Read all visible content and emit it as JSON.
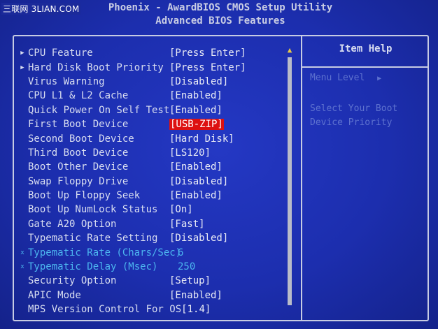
{
  "watermark": "三联网 3LIAN.COM",
  "header": {
    "line1": "Phoenix - AwardBIOS CMOS Setup Utility",
    "line2": "Advanced BIOS Features"
  },
  "items": [
    {
      "marker": "▶",
      "label": "CPU Feature",
      "value": "[Press Enter]"
    },
    {
      "marker": "▶",
      "label": "Hard Disk Boot Priority",
      "value": "[Press Enter]"
    },
    {
      "marker": "",
      "label": "Virus Warning",
      "value": "[Disabled]"
    },
    {
      "marker": "",
      "label": "CPU L1 & L2 Cache",
      "value": "[Enabled]"
    },
    {
      "marker": "",
      "label": "Quick Power On Self Test",
      "value": "[Enabled]"
    },
    {
      "marker": "",
      "label": "First Boot Device",
      "value": "[USB-ZIP]"
    },
    {
      "marker": "",
      "label": "Second Boot Device",
      "value": "[Hard Disk]"
    },
    {
      "marker": "",
      "label": "Third Boot Device",
      "value": "[LS120]"
    },
    {
      "marker": "",
      "label": "Boot Other Device",
      "value": "[Enabled]"
    },
    {
      "marker": "",
      "label": "Swap Floppy Drive",
      "value": "[Disabled]"
    },
    {
      "marker": "",
      "label": "Boot Up Floppy Seek",
      "value": "[Enabled]"
    },
    {
      "marker": "",
      "label": "Boot Up NumLock Status",
      "value": "[On]"
    },
    {
      "marker": "",
      "label": "Gate A20 Option",
      "value": "[Fast]"
    },
    {
      "marker": "",
      "label": "Typematic Rate Setting",
      "value": "[Disabled]"
    },
    {
      "marker": "x",
      "label": "Typematic Rate (Chars/Sec)",
      "value": "6"
    },
    {
      "marker": "x",
      "label": "Typematic Delay (Msec)",
      "value": "250"
    },
    {
      "marker": "",
      "label": "Security Option",
      "value": "[Setup]"
    },
    {
      "marker": "",
      "label": "APIC Mode",
      "value": "[Enabled]"
    },
    {
      "marker": "",
      "label": "MPS Version Control For OS",
      "value": "[1.4]"
    }
  ],
  "selected_value": "[USB-ZIP]",
  "help": {
    "title": "Item Help",
    "menu_level": "Menu Level",
    "menu_arrow": "▶",
    "text_line1": "Select Your Boot",
    "text_line2": "Device Priority"
  },
  "colors": {
    "background": "#1c2eae",
    "selected_bg": "#dd1111",
    "disabled_text": "#4cb6ef"
  }
}
